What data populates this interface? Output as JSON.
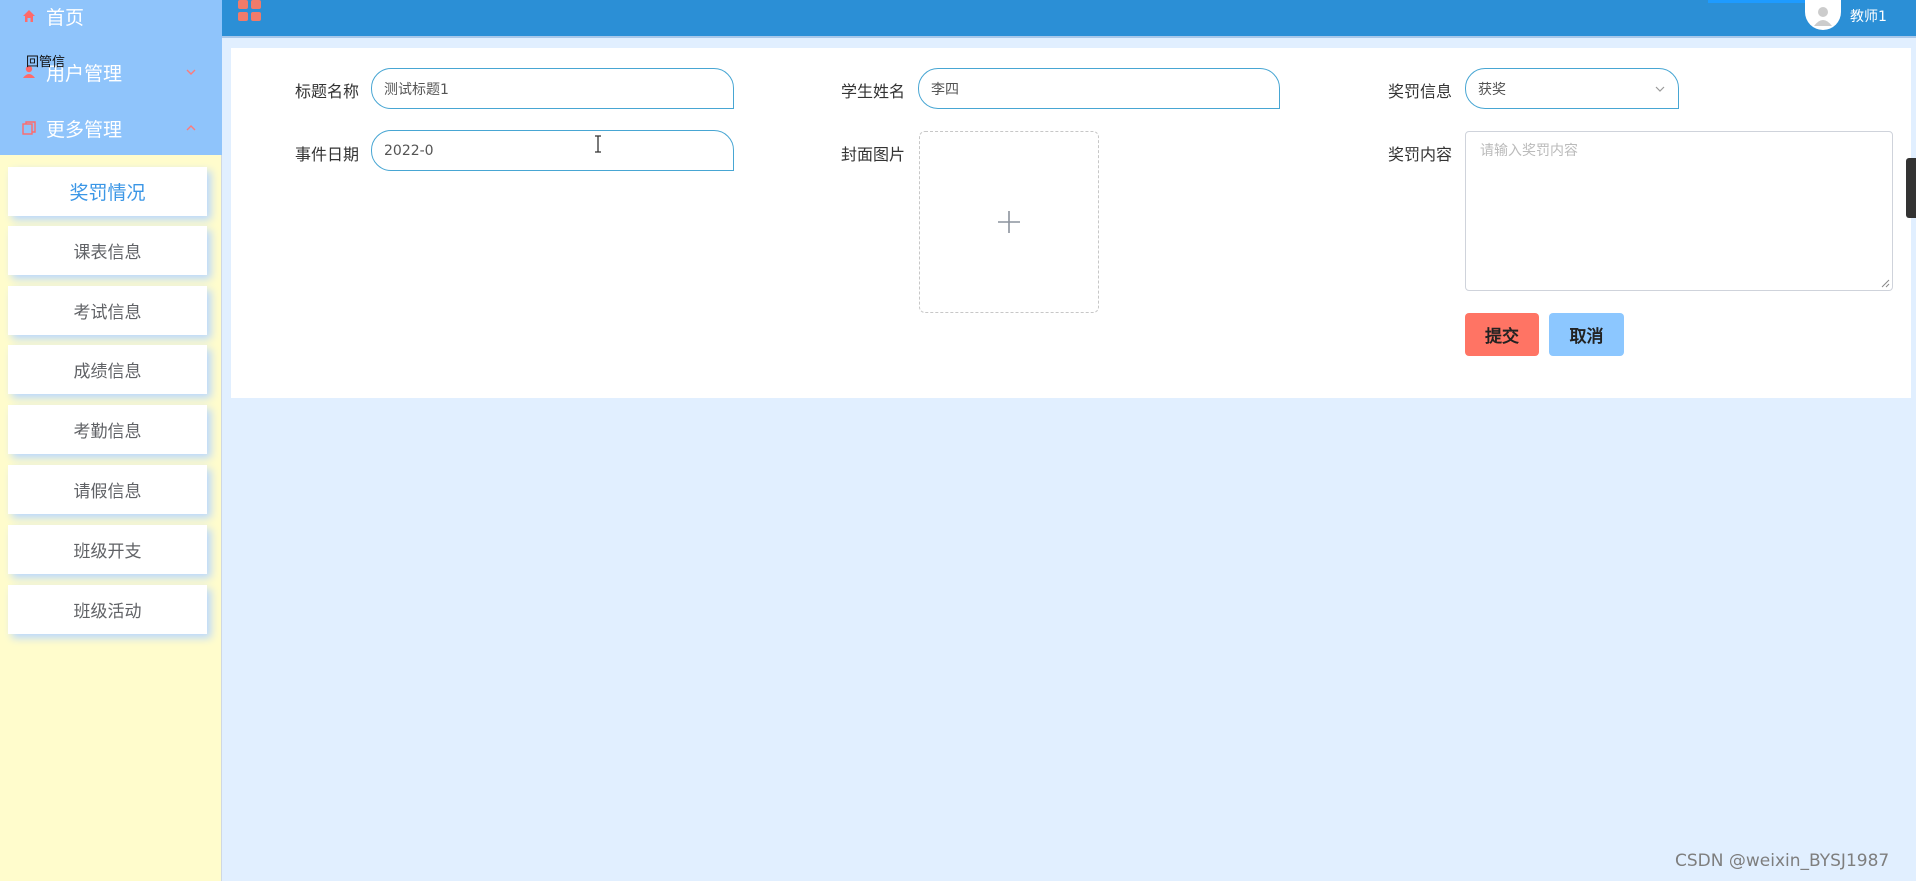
{
  "sidebar": {
    "menu": [
      {
        "label": "首页",
        "icon": "home-icon"
      },
      {
        "label": "用户管理",
        "icon": "user-icon"
      },
      {
        "label": "更多管理",
        "icon": "copy-icon"
      }
    ],
    "tooltip_text": "回管信",
    "sub_items": [
      {
        "label": "奖罚情况"
      },
      {
        "label": "课表信息"
      },
      {
        "label": "考试信息"
      },
      {
        "label": "成绩信息"
      },
      {
        "label": "考勤信息"
      },
      {
        "label": "请假信息"
      },
      {
        "label": "班级开支"
      },
      {
        "label": "班级活动"
      }
    ],
    "colors": {
      "top_bg": "#8fc4fb",
      "bottom_bg": "#fffccc",
      "active_text": "#3a96e6"
    }
  },
  "header": {
    "username": "教师1",
    "colors": {
      "bg": "#2b8fd6",
      "grid_icon": "#f17b6a"
    }
  },
  "form": {
    "title": {
      "label": "标题名称",
      "value": "测试标题1"
    },
    "student": {
      "label": "学生姓名",
      "value": "李四"
    },
    "reward": {
      "label": "奖罚信息",
      "value": "获奖"
    },
    "date": {
      "label": "事件日期",
      "value": "2022-0"
    },
    "cover": {
      "label": "封面图片"
    },
    "content": {
      "label": "奖罚内容",
      "placeholder": "请输入奖罚内容"
    },
    "submit_label": "提交",
    "cancel_label": "取消",
    "colors": {
      "submit": "#ff7464",
      "cancel": "#8cc7ff",
      "input_border": "#48a6d3"
    }
  },
  "watermark": "CSDN @weixin_BYSJ1987"
}
